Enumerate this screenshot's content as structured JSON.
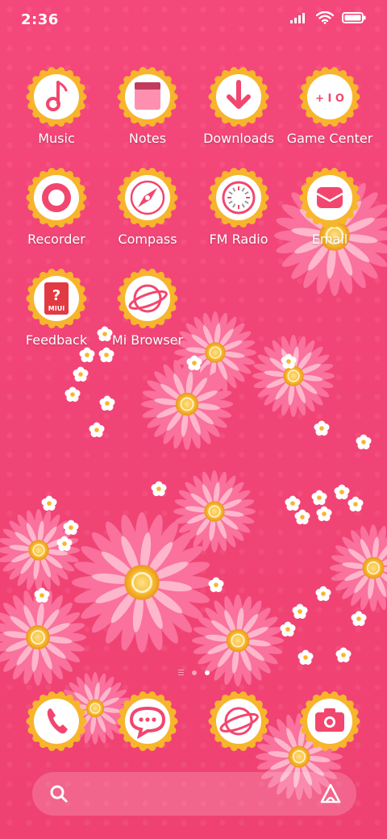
{
  "status_bar": {
    "time": "2:36",
    "icons": [
      "signal-icon",
      "wifi-icon",
      "battery-icon"
    ]
  },
  "home_apps": [
    {
      "label": "Music",
      "icon": "music-note-icon"
    },
    {
      "label": "Notes",
      "icon": "notes-icon"
    },
    {
      "label": "Downloads",
      "icon": "download-arrow-icon"
    },
    {
      "label": "Game Center",
      "icon": "gamepad-icon"
    },
    {
      "label": "Recorder",
      "icon": "record-icon"
    },
    {
      "label": "Compass",
      "icon": "compass-icon"
    },
    {
      "label": "FM Radio",
      "icon": "radio-dial-icon"
    },
    {
      "label": "Email",
      "icon": "envelope-icon"
    },
    {
      "label": "Feedback",
      "icon": "feedback-miui-icon",
      "icon_text": "MIUI"
    },
    {
      "label": "Mi Browser",
      "icon": "planet-icon"
    }
  ],
  "page_indicator": {
    "pages": 2,
    "active_page": 2
  },
  "dock_apps": [
    {
      "name": "Phone",
      "icon": "phone-icon"
    },
    {
      "name": "Messaging",
      "icon": "chat-bubble-icon"
    },
    {
      "name": "Browser",
      "icon": "planet-icon"
    },
    {
      "name": "Camera",
      "icon": "camera-icon"
    }
  ],
  "search_bar": {
    "icons": [
      "search-icon",
      "assistant-icon"
    ]
  },
  "colors": {
    "background": "#f24777",
    "icon_ring": "#f7b52c",
    "icon_face": "#ffffff",
    "icon_accent": "#f2466f"
  }
}
